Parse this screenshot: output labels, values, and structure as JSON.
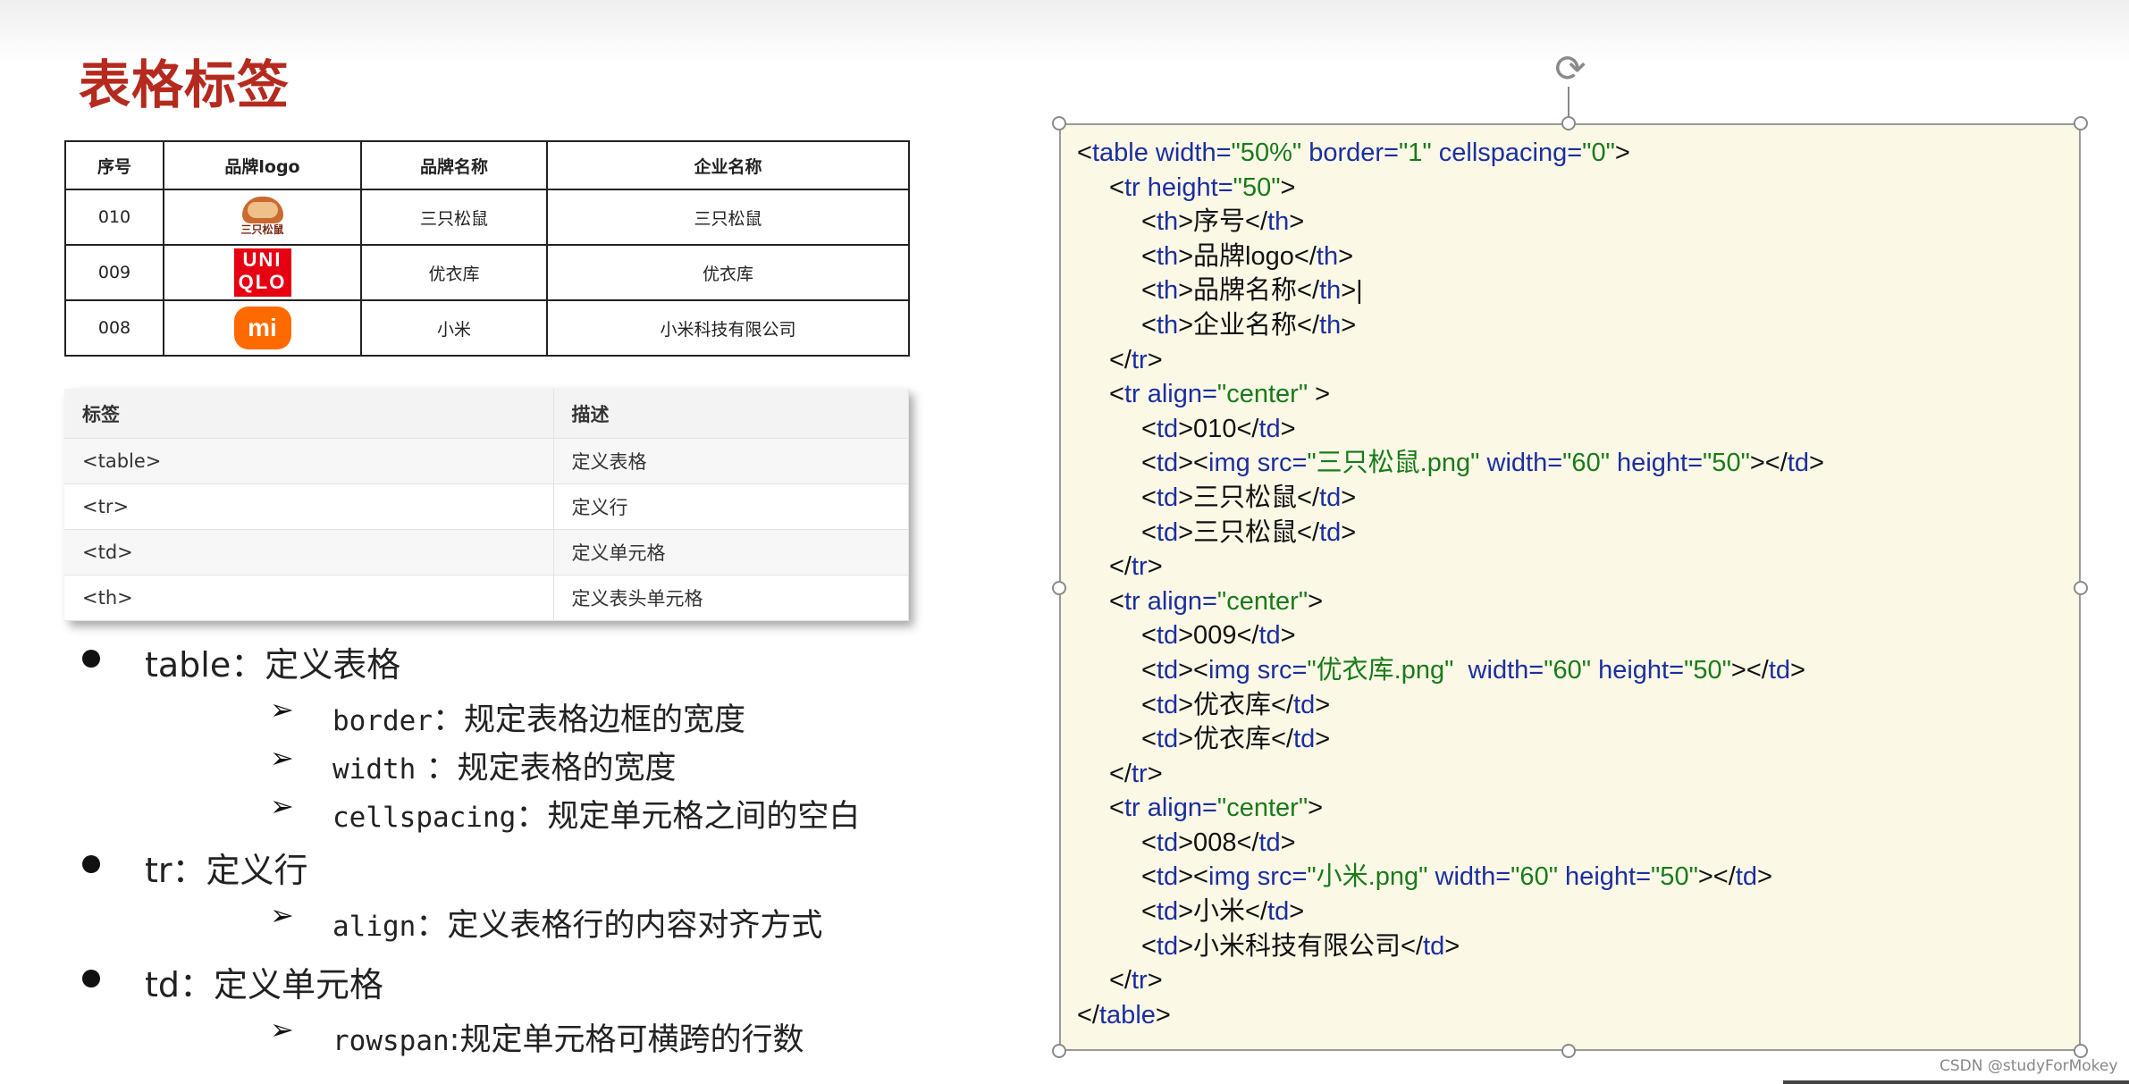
{
  "title": "表格标签",
  "brand_table": {
    "headers": [
      "序号",
      "品牌logo",
      "品牌名称",
      "企业名称"
    ],
    "rows": [
      {
        "id": "010",
        "logo": "三只松鼠",
        "brand": "三只松鼠",
        "company": "三只松鼠"
      },
      {
        "id": "009",
        "logo_lines": [
          "UNI",
          "QLO"
        ],
        "brand": "优衣库",
        "company": "优衣库"
      },
      {
        "id": "008",
        "logo": "mi",
        "brand": "小米",
        "company": "小米科技有限公司"
      }
    ]
  },
  "tag_table": {
    "headers": [
      "标签",
      "描述"
    ],
    "rows": [
      [
        "<table>",
        "定义表格"
      ],
      [
        "<tr>",
        "定义行"
      ],
      [
        "<td>",
        "定义单元格"
      ],
      [
        "<th>",
        "定义表头单元格"
      ]
    ]
  },
  "bullets": [
    {
      "text": "table：定义表格",
      "subs": [
        {
          "code": "border",
          "text": "：规定表格边框的宽度"
        },
        {
          "code": "width",
          "text": " ：规定表格的宽度"
        },
        {
          "code": "cellspacing",
          "text": "：规定单元格之间的空白"
        }
      ]
    },
    {
      "text": "tr：定义行",
      "subs": [
        {
          "code": "align",
          "text": "：定义表格行的内容对齐方式"
        }
      ]
    },
    {
      "text": "td：定义单元格",
      "subs": [
        {
          "code": "rowspan",
          "text": ":规定单元格可横跨的行数"
        }
      ]
    }
  ],
  "code_lines": [
    {
      "indent": 0,
      "parts": [
        [
          "t",
          "<"
        ],
        [
          "k",
          "table width="
        ],
        [
          "v",
          "\"50%\""
        ],
        [
          "k",
          " border="
        ],
        [
          "v",
          "\"1\""
        ],
        [
          "k",
          " cellspacing="
        ],
        [
          "v",
          "\"0\""
        ],
        [
          "t",
          ">"
        ]
      ]
    },
    {
      "indent": 1,
      "parts": [
        [
          "t",
          "<"
        ],
        [
          "k",
          "tr height="
        ],
        [
          "v",
          "\"50\""
        ],
        [
          "t",
          ">"
        ]
      ]
    },
    {
      "indent": 2,
      "parts": [
        [
          "t",
          "<"
        ],
        [
          "k",
          "th"
        ],
        [
          "t",
          ">序号</"
        ],
        [
          "k",
          "th"
        ],
        [
          "t",
          ">"
        ]
      ]
    },
    {
      "indent": 2,
      "parts": [
        [
          "t",
          "<"
        ],
        [
          "k",
          "th"
        ],
        [
          "t",
          ">品牌logo</"
        ],
        [
          "k",
          "th"
        ],
        [
          "t",
          ">"
        ]
      ]
    },
    {
      "indent": 2,
      "parts": [
        [
          "t",
          "<"
        ],
        [
          "k",
          "th"
        ],
        [
          "t",
          ">品牌名称</"
        ],
        [
          "k",
          "th"
        ],
        [
          "t",
          ">|"
        ]
      ]
    },
    {
      "indent": 2,
      "parts": [
        [
          "t",
          "<"
        ],
        [
          "k",
          "th"
        ],
        [
          "t",
          ">企业名称</"
        ],
        [
          "k",
          "th"
        ],
        [
          "t",
          ">"
        ]
      ]
    },
    {
      "indent": 1,
      "parts": [
        [
          "t",
          "</"
        ],
        [
          "k",
          "tr"
        ],
        [
          "t",
          ">"
        ]
      ]
    },
    {
      "indent": 1,
      "parts": [
        [
          "t",
          "<"
        ],
        [
          "k",
          "tr align="
        ],
        [
          "v",
          "\"center\""
        ],
        [
          "t",
          " >"
        ]
      ]
    },
    {
      "indent": 2,
      "parts": [
        [
          "t",
          "<"
        ],
        [
          "k",
          "td"
        ],
        [
          "t",
          ">010</"
        ],
        [
          "k",
          "td"
        ],
        [
          "t",
          ">"
        ]
      ]
    },
    {
      "indent": 2,
      "parts": [
        [
          "t",
          "<"
        ],
        [
          "k",
          "td"
        ],
        [
          "t",
          "><"
        ],
        [
          "k",
          "img src="
        ],
        [
          "v",
          "\"三只松鼠.png\""
        ],
        [
          "k",
          " width="
        ],
        [
          "v",
          "\"60\""
        ],
        [
          "k",
          " height="
        ],
        [
          "v",
          "\"50\""
        ],
        [
          "t",
          "></"
        ],
        [
          "k",
          "td"
        ],
        [
          "t",
          ">"
        ]
      ]
    },
    {
      "indent": 2,
      "parts": [
        [
          "t",
          "<"
        ],
        [
          "k",
          "td"
        ],
        [
          "t",
          ">三只松鼠</"
        ],
        [
          "k",
          "td"
        ],
        [
          "t",
          ">"
        ]
      ]
    },
    {
      "indent": 2,
      "parts": [
        [
          "t",
          "<"
        ],
        [
          "k",
          "td"
        ],
        [
          "t",
          ">三只松鼠</"
        ],
        [
          "k",
          "td"
        ],
        [
          "t",
          ">"
        ]
      ]
    },
    {
      "indent": 1,
      "parts": [
        [
          "t",
          "</"
        ],
        [
          "k",
          "tr"
        ],
        [
          "t",
          ">"
        ]
      ]
    },
    {
      "indent": 1,
      "parts": [
        [
          "t",
          "<"
        ],
        [
          "k",
          "tr align="
        ],
        [
          "v",
          "\"center\""
        ],
        [
          "t",
          ">"
        ]
      ]
    },
    {
      "indent": 2,
      "parts": [
        [
          "t",
          "<"
        ],
        [
          "k",
          "td"
        ],
        [
          "t",
          ">009</"
        ],
        [
          "k",
          "td"
        ],
        [
          "t",
          ">"
        ]
      ]
    },
    {
      "indent": 2,
      "parts": [
        [
          "t",
          "<"
        ],
        [
          "k",
          "td"
        ],
        [
          "t",
          "><"
        ],
        [
          "k",
          "img src="
        ],
        [
          "v",
          "\"优衣库.png\""
        ],
        [
          "k",
          "  width="
        ],
        [
          "v",
          "\"60\""
        ],
        [
          "k",
          " height="
        ],
        [
          "v",
          "\"50\""
        ],
        [
          "t",
          "></"
        ],
        [
          "k",
          "td"
        ],
        [
          "t",
          ">"
        ]
      ]
    },
    {
      "indent": 2,
      "parts": [
        [
          "t",
          "<"
        ],
        [
          "k",
          "td"
        ],
        [
          "t",
          ">优衣库</"
        ],
        [
          "k",
          "td"
        ],
        [
          "t",
          ">"
        ]
      ]
    },
    {
      "indent": 2,
      "parts": [
        [
          "t",
          "<"
        ],
        [
          "k",
          "td"
        ],
        [
          "t",
          ">优衣库</"
        ],
        [
          "k",
          "td"
        ],
        [
          "t",
          ">"
        ]
      ]
    },
    {
      "indent": 1,
      "parts": [
        [
          "t",
          "</"
        ],
        [
          "k",
          "tr"
        ],
        [
          "t",
          ">"
        ]
      ]
    },
    {
      "indent": 1,
      "parts": [
        [
          "t",
          "<"
        ],
        [
          "k",
          "tr align="
        ],
        [
          "v",
          "\"center\""
        ],
        [
          "t",
          ">"
        ]
      ]
    },
    {
      "indent": 2,
      "parts": [
        [
          "t",
          "<"
        ],
        [
          "k",
          "td"
        ],
        [
          "t",
          ">008</"
        ],
        [
          "k",
          "td"
        ],
        [
          "t",
          ">"
        ]
      ]
    },
    {
      "indent": 2,
      "parts": [
        [
          "t",
          "<"
        ],
        [
          "k",
          "td"
        ],
        [
          "t",
          "><"
        ],
        [
          "k",
          "img src="
        ],
        [
          "v",
          "\"小米.png\""
        ],
        [
          "k",
          " width="
        ],
        [
          "v",
          "\"60\""
        ],
        [
          "k",
          " height="
        ],
        [
          "v",
          "\"50\""
        ],
        [
          "t",
          "></"
        ],
        [
          "k",
          "td"
        ],
        [
          "t",
          ">"
        ]
      ]
    },
    {
      "indent": 2,
      "parts": [
        [
          "t",
          "<"
        ],
        [
          "k",
          "td"
        ],
        [
          "t",
          ">小米</"
        ],
        [
          "k",
          "td"
        ],
        [
          "t",
          ">"
        ]
      ]
    },
    {
      "indent": 2,
      "parts": [
        [
          "t",
          "<"
        ],
        [
          "k",
          "td"
        ],
        [
          "t",
          ">小米科技有限公司</"
        ],
        [
          "k",
          "td"
        ],
        [
          "t",
          ">"
        ]
      ]
    },
    {
      "indent": 1,
      "parts": [
        [
          "t",
          "</"
        ],
        [
          "k",
          "tr"
        ],
        [
          "t",
          ">"
        ]
      ]
    },
    {
      "indent": 0,
      "parts": [
        [
          "t",
          "</"
        ],
        [
          "k",
          "table"
        ],
        [
          "t",
          ">"
        ]
      ]
    }
  ],
  "watermark": "CSDN @studyForMokey",
  "colors": {
    "title": "#b52a1e",
    "code_keyword": "#1c2ea0",
    "code_value": "#1a7a1a",
    "code_bg": "#fbf9e6"
  }
}
